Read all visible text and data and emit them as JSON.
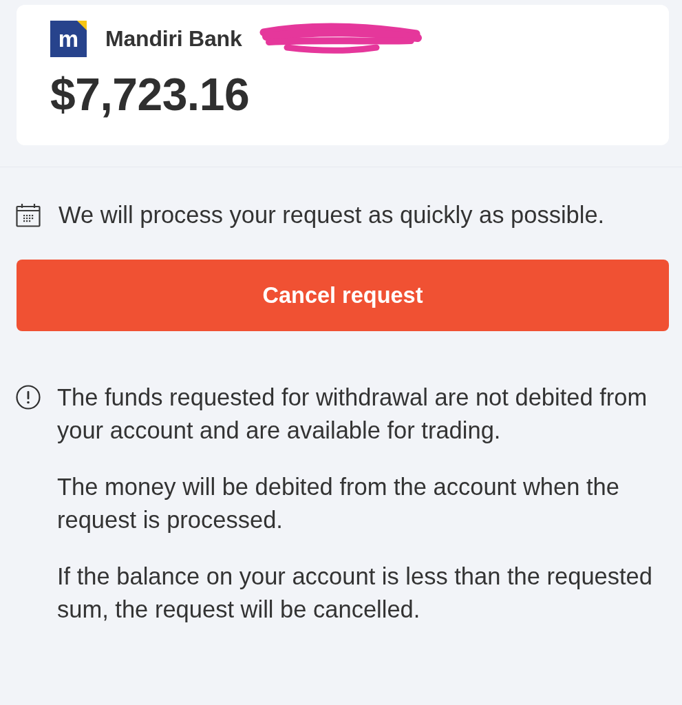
{
  "account_card": {
    "bank_logo": "m",
    "bank_name": "Mandiri Bank",
    "amount": "$7,723.16"
  },
  "notice": {
    "text": "We will process your request as quickly as possible."
  },
  "cancel_button": {
    "label": "Cancel request"
  },
  "info": {
    "paragraphs": [
      "The funds requested for withdrawal are not debited from your account and are available for trading.",
      "The money will be debited from the account when the request is processed.",
      "If the balance on your account is less than the requested sum, the request will be cancelled."
    ]
  }
}
